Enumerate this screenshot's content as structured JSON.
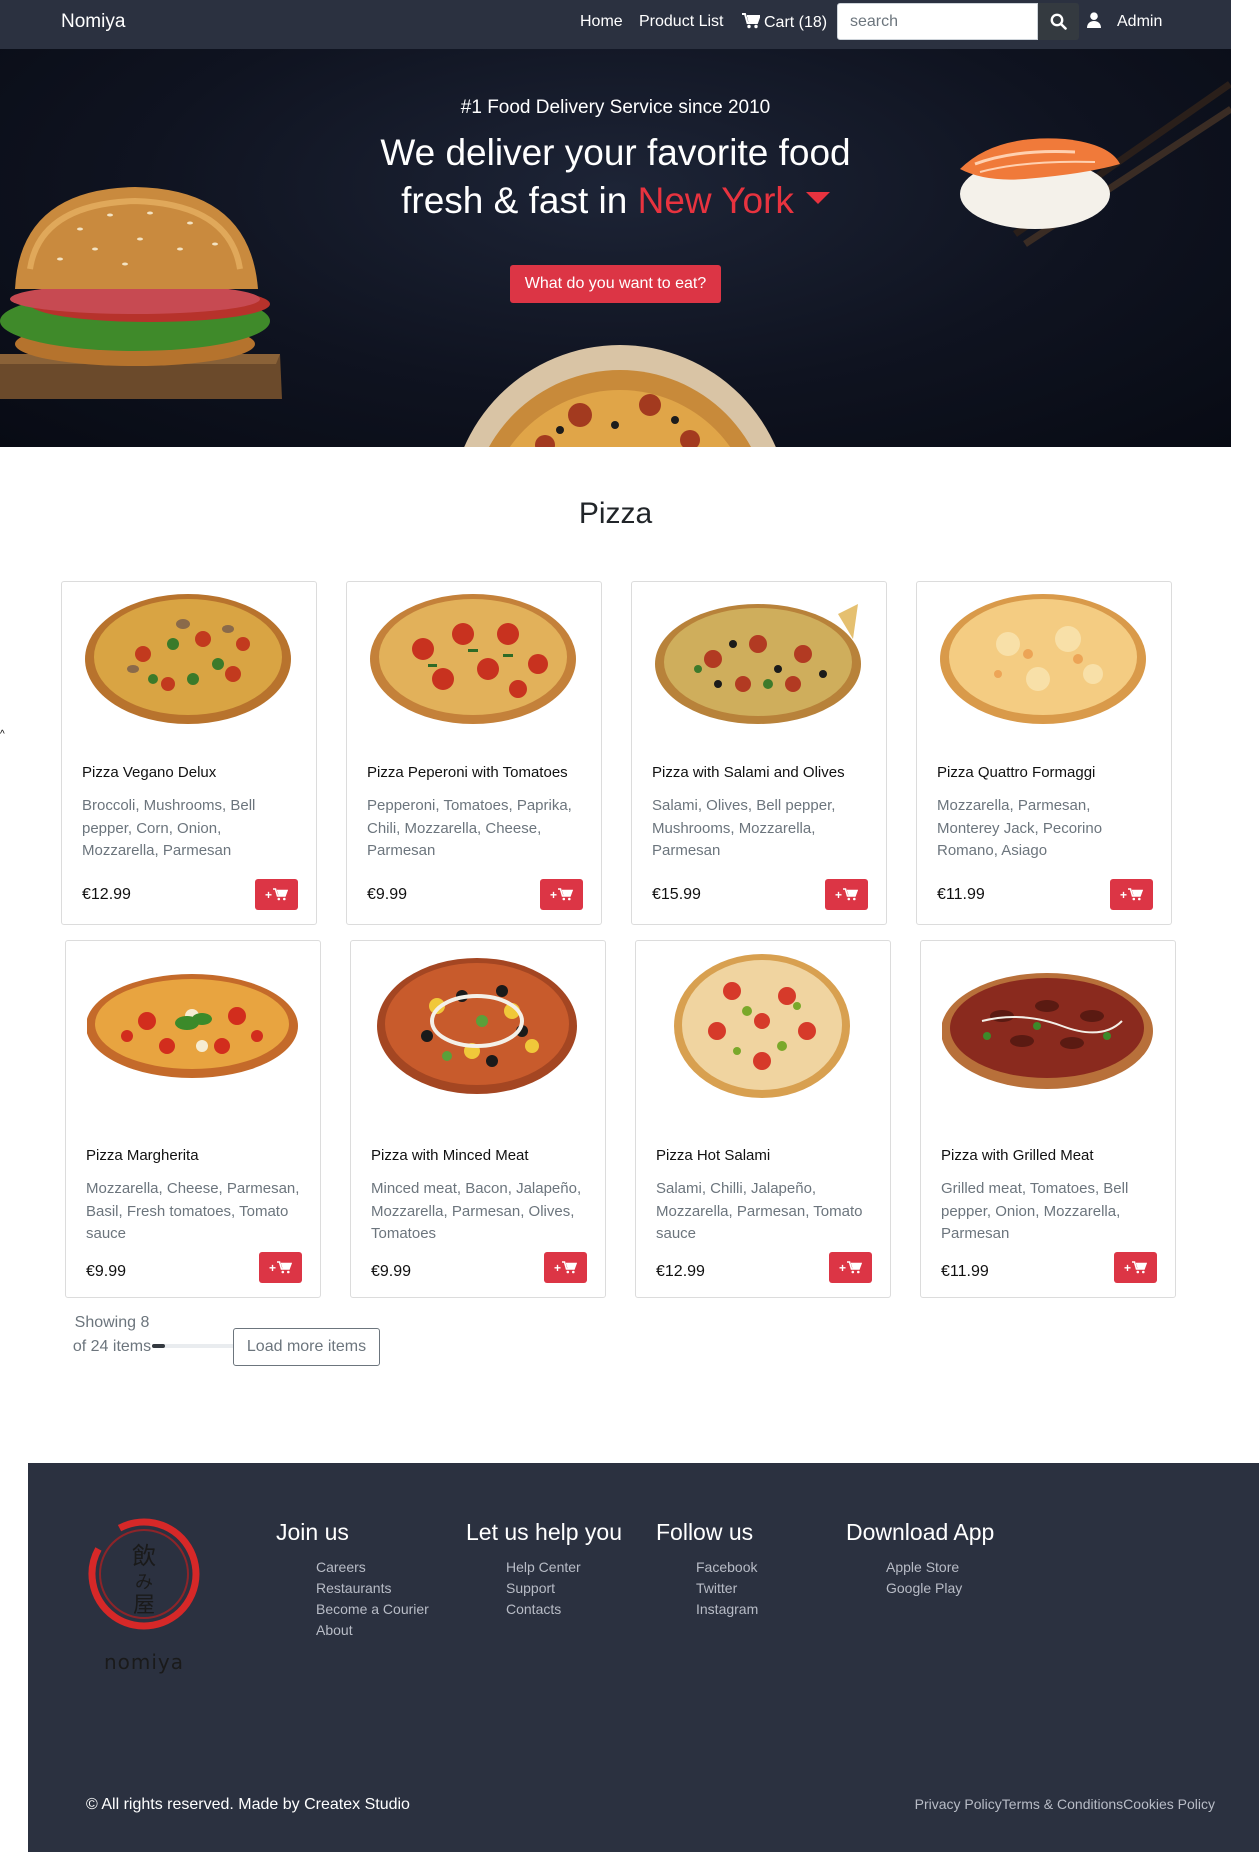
{
  "nav": {
    "brand": "Nomiya",
    "home": "Home",
    "products": "Product List",
    "cart": "Cart (18)",
    "search_placeholder": "search",
    "admin": "Admin"
  },
  "hero": {
    "kicker": "#1 Food Delivery Service since 2010",
    "title_line1": "We deliver your favorite food",
    "title_line2": "fresh & fast in",
    "city": "New York",
    "cta": "What do you want to eat?"
  },
  "section": {
    "title": "Pizza"
  },
  "products": [
    {
      "name": "Pizza Vegano Delux",
      "desc": "Broccoli, Mushrooms, Bell pepper, Corn, Onion, Mozzarella, Parmesan",
      "price": "€12.99",
      "style": "vegano"
    },
    {
      "name": "Pizza Peperoni with Tomatoes",
      "desc": "Pepperoni, Tomatoes, Paprika, Chili, Mozzarella, Cheese, Parmesan",
      "price": "€9.99",
      "style": "peperoni"
    },
    {
      "name": "Pizza with Salami and Olives",
      "desc": "Salami, Olives, Bell pepper, Mushrooms, Mozzarella, Parmesan",
      "price": "€15.99",
      "style": "salami"
    },
    {
      "name": "Pizza Quattro Formaggi",
      "desc": "Mozzarella, Parmesan, Monterey Jack, Pecorino Romano, Asiago",
      "price": "€11.99",
      "style": "formaggi"
    },
    {
      "name": "Pizza Margherita",
      "desc": "Mozzarella, Cheese, Parmesan, Basil, Fresh tomatoes, Tomato sauce",
      "price": "€9.99",
      "style": "margherita"
    },
    {
      "name": "Pizza with Minced Meat",
      "desc": "Minced meat, Bacon, Jalapeño, Mozzarella, Parmesan, Olives, Tomatoes",
      "price": "€9.99",
      "style": "minced"
    },
    {
      "name": "Pizza Hot Salami",
      "desc": "Salami, Chilli, Jalapeño, Mozzarella, Parmesan, Tomato sauce",
      "price": "€12.99",
      "style": "hotsalami"
    },
    {
      "name": "Pizza with Grilled Meat",
      "desc": "Grilled meat, Tomatoes, Bell pepper, Onion, Mozzarella, Parmesan",
      "price": "€11.99",
      "style": "grilled"
    }
  ],
  "add_to_cart_label": "+",
  "pagination": {
    "showing": "Showing 8 of 24 items",
    "progress": 0.33,
    "load_more": "Load more items"
  },
  "footer": {
    "logo_text": "nomiya",
    "logo_kanji": "飲み屋",
    "columns": [
      {
        "title": "Join us",
        "links": [
          "Careers",
          "Restaurants",
          "Become a Courier",
          "About"
        ]
      },
      {
        "title": "Let us help you",
        "links": [
          "Help Center",
          "Support",
          "Contacts"
        ]
      },
      {
        "title": "Follow us",
        "links": [
          "Facebook",
          "Twitter",
          "Instagram"
        ]
      },
      {
        "title": "Download App",
        "links": [
          "Apple Store",
          "Google Play"
        ]
      }
    ],
    "copyright": "© All rights reserved. Made by Createx Studio",
    "legal": [
      "Privacy Policy",
      "Terms & Conditions",
      "Cookies Policy"
    ]
  },
  "colors": {
    "navbar": "#2b3140",
    "accent_red": "#dc3545",
    "hero_bg": "#0f1320"
  }
}
